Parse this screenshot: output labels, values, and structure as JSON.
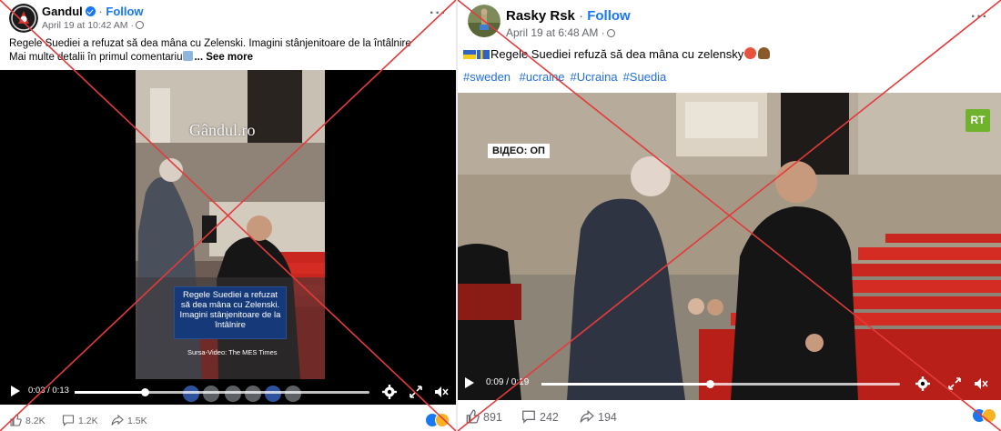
{
  "left_post": {
    "author": "Gandul",
    "follow_label": "Follow",
    "separator": "·",
    "timestamp": "April 19 at 10:42 AM",
    "text_line1": "Regele Suediei a refuzat să dea mâna cu Zelenski. Imagini stânjenitoare de la întâlnire",
    "text_line2": "Mai multe detalii în primul comentariu",
    "see_more": "... See more",
    "video": {
      "watermark": "Gândul.ro",
      "caption": "Regele Suediei a refuzat să dea mâna cu Zelenski. Imagini stânjenitoare de la întâlnire",
      "source": "Sursa-Video: The MES Times",
      "time_display": "0:03 / 0:13",
      "progress": 0.24
    },
    "stats": {
      "reactions": "8.2K",
      "comments": "1.2K",
      "shares": "1.5K"
    }
  },
  "right_post": {
    "author": "Rasky Rsk",
    "follow_label": "Follow",
    "separator": "·",
    "timestamp": "April 19 at 6:48 AM",
    "text": "Regele Suediei refuză să dea mâna cu zelensky",
    "hashtags": [
      "#sweden",
      "#ucraine",
      "#Ucraina",
      "#Suedia"
    ],
    "video": {
      "overlay_tag": "ВІДЕО: ОП",
      "logo": "RT",
      "time_display": "0:09 / 0:19",
      "progress": 0.47
    },
    "stats": {
      "reactions": "891",
      "comments": "242",
      "shares": "194"
    }
  },
  "colors": {
    "facebook_blue": "#1877f2",
    "hashtag_blue": "#216fdb",
    "cross_red": "#e23b3b",
    "carpet_red": "#d42b22",
    "caption_blue": "#163a79"
  }
}
